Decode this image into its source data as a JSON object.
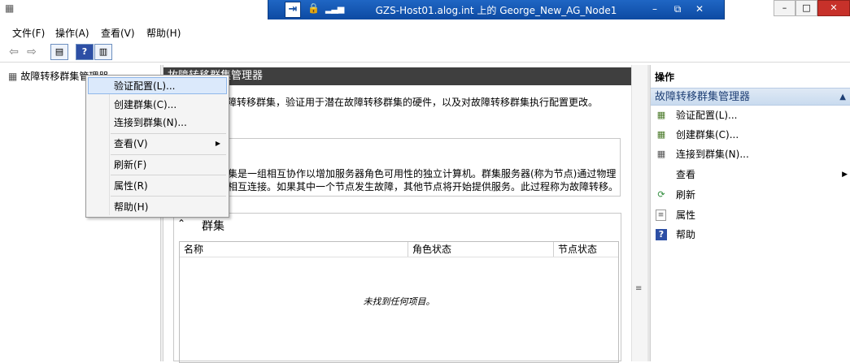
{
  "window": {
    "remote_title": "GZS-Host01.alog.int 上的 George_New_AG_Node1",
    "rdp_minimize": "–",
    "rdp_restore": "⧉",
    "rdp_close": "✕",
    "min_label": "–",
    "max_label": "□",
    "close_label": "✕"
  },
  "menubar": [
    "文件(F)",
    "操作(A)",
    "查看(V)",
    "帮助(H)"
  ],
  "tree": {
    "root_label": "故障转移群集管理器"
  },
  "center": {
    "header": "故障转移群集管理器",
    "description": "障转移群集，验证用于潜在故障转移群集的硬件，以及对故障转移群集执行配置更改。",
    "overview_line1": "集是一组相互协作以增加服务器角色可用性的独立计算机。群集服务器(称为节点)通过物理",
    "overview_line2": "相互连接。如果其中一个节点发生故障，其他节点将开始提供服务。此过程称为故障转移。",
    "clusters_title": "群集",
    "columns": [
      "名称",
      "角色状态",
      "节点状态"
    ],
    "empty_text": "未找到任何项目。"
  },
  "actions": {
    "title": "操作",
    "section": "故障转移群集管理器",
    "items": [
      {
        "label": "验证配置(L)...",
        "icon": "validate-icon"
      },
      {
        "label": "创建群集(C)...",
        "icon": "create-cluster-icon"
      },
      {
        "label": "连接到群集(N)...",
        "icon": "connect-icon"
      },
      {
        "label": "查看",
        "icon": "none",
        "submenu": true
      },
      {
        "label": "刷新",
        "icon": "refresh-icon"
      },
      {
        "label": "属性",
        "icon": "properties-icon"
      },
      {
        "label": "帮助",
        "icon": "help-icon"
      }
    ]
  },
  "context_menu": {
    "items": [
      {
        "label": "验证配置(L)..."
      },
      {
        "label": "创建群集(C)..."
      },
      {
        "label": "连接到群集(N)..."
      },
      {
        "label": "查看(V)",
        "submenu": true
      },
      {
        "label": "刷新(F)"
      },
      {
        "label": "属性(R)"
      },
      {
        "label": "帮助(H)"
      }
    ]
  },
  "colors": {
    "rdp_bar": "#0d4aa2",
    "center_header": "#3f3f3f",
    "actions_section": "#c9dbef",
    "menu_highlight": "#dbe9fb"
  }
}
